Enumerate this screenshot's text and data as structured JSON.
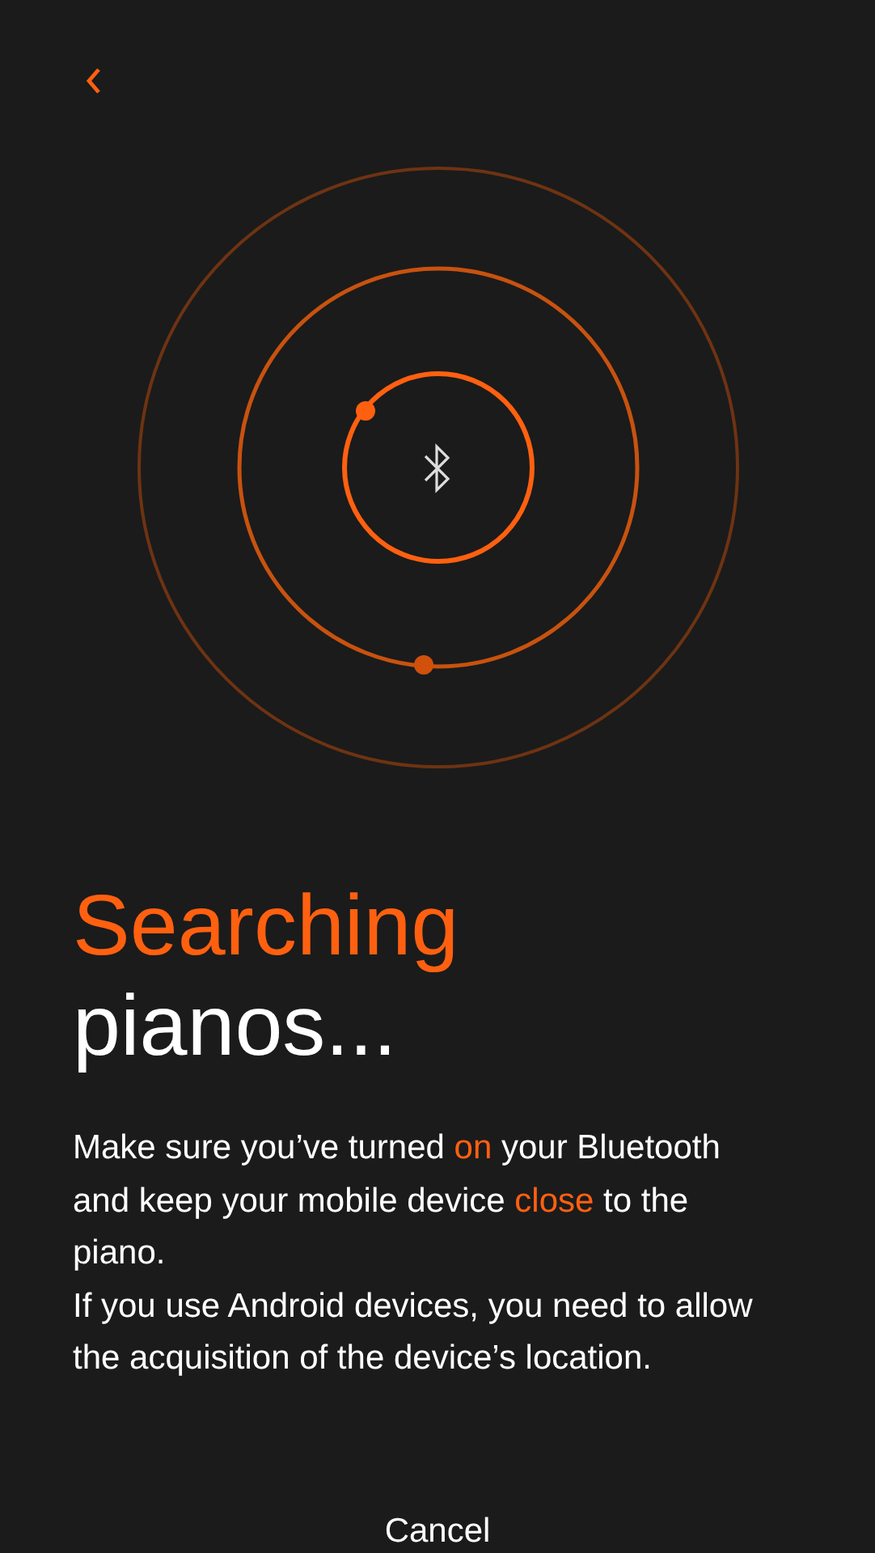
{
  "title": [
    {
      "text": "Searching",
      "highlight": true
    },
    {
      "text": "pianos...",
      "highlight": false
    }
  ],
  "paragraphs": [
    {
      "segments": [
        {
          "text": "Make sure you’ve turned ",
          "highlight": false
        },
        {
          "text": "on",
          "highlight": true
        },
        {
          "text": " your Bluetooth and keep your mobile device ",
          "highlight": false
        },
        {
          "text": "close",
          "highlight": true
        },
        {
          "text": " to the piano.",
          "highlight": false
        }
      ]
    },
    {
      "segments": [
        {
          "text": "If you use Android devices, you need to allow the acquisition of the device’s location.",
          "highlight": false
        }
      ]
    }
  ],
  "cancel": {
    "label": "Cancel"
  }
}
